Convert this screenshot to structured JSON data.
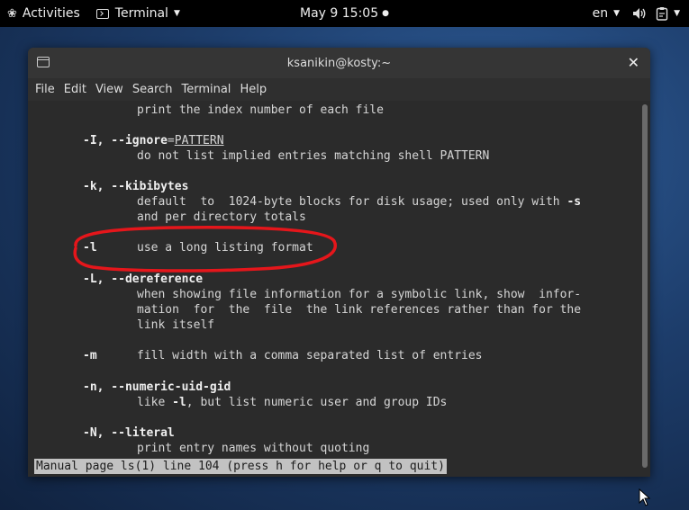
{
  "topbar": {
    "activities": "Activities",
    "app_menu": "Terminal",
    "clock": "May 9  15:05",
    "language": "en"
  },
  "window": {
    "title": "ksanikin@kosty:~",
    "menu": [
      "File",
      "Edit",
      "View",
      "Search",
      "Terminal",
      "Help"
    ]
  },
  "terminal": {
    "l0": "print the index number of each file",
    "opt_I_a": "-I, --ignore",
    "opt_I_eq": "=",
    "opt_I_arg": "PATTERN",
    "l1": "do not list implied entries matching shell PATTERN",
    "opt_k": "-k, --kibibytes",
    "l2": "default  to  1024-byte blocks for disk usage; used only with ",
    "l2_s": "-s",
    "l3": "and per directory totals",
    "opt_l": "-l",
    "l4": "use a long listing format",
    "opt_L": "-L, --dereference",
    "l5": "when showing file information for a symbolic link, show  infor-",
    "l6": "mation  for  the  file  the link references rather than for the",
    "l7": "link itself",
    "opt_m": "-m",
    "l8": "fill width with a comma separated list of entries",
    "opt_n": "-n, --numeric-uid-gid",
    "l9_pre": "like ",
    "l9_l": "-l",
    "l9_post": ", but list numeric user and group IDs",
    "opt_N": "-N, --literal",
    "l10": "print entry names without quoting",
    "status": "Manual page ls(1) line 104 (press h for help or q to quit)"
  },
  "colors": {
    "annotation": "#e5161b"
  }
}
